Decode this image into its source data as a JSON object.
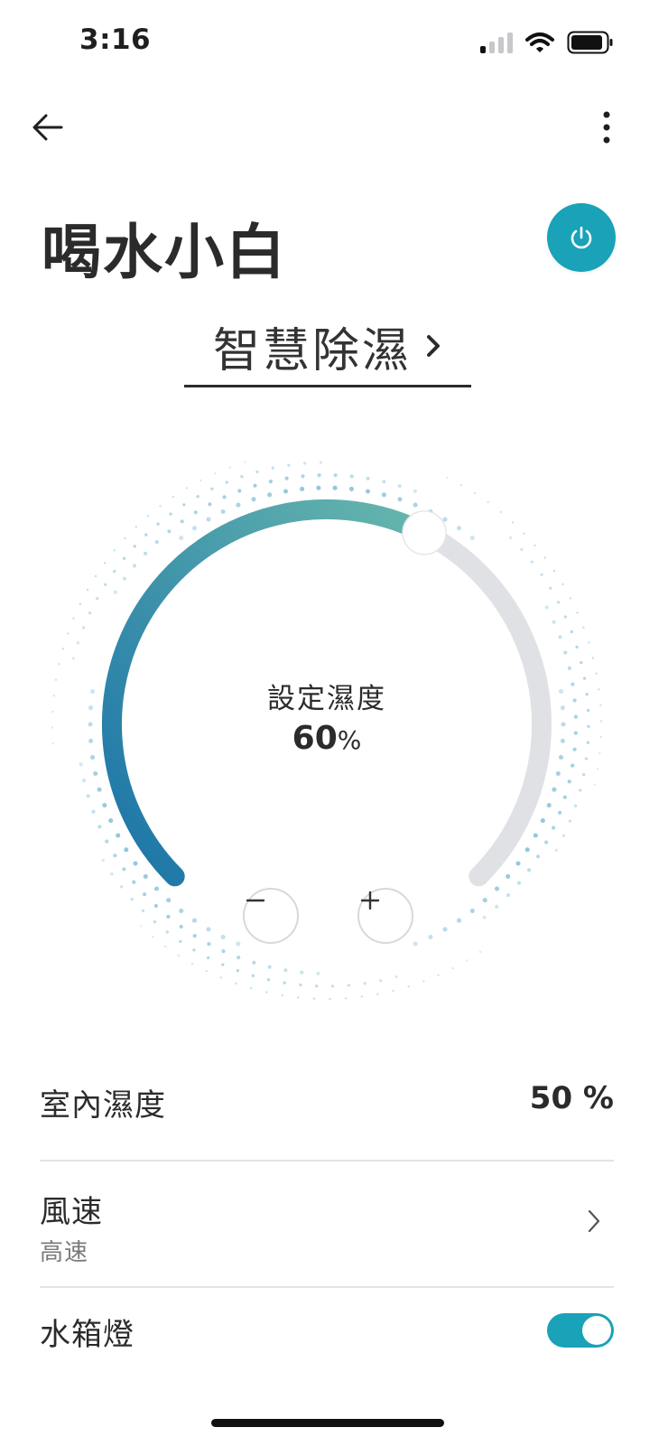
{
  "status_bar": {
    "time": "3:16",
    "signal_bars_active": 1,
    "signal_bars_total": 4,
    "icons": [
      "cellular-signal-icon",
      "wifi-icon",
      "battery-icon"
    ]
  },
  "nav": {
    "back_icon": "arrow-left-icon",
    "more_icon": "more-vertical-icon"
  },
  "device": {
    "name": "喝水小白",
    "power_icon": "power-icon",
    "power_color": "#19a2b8"
  },
  "mode": {
    "label": "智慧除濕",
    "chevron": "›"
  },
  "dial": {
    "label": "設定濕度",
    "value": "60",
    "unit": "%",
    "level_fraction": 0.6,
    "minus_icon": "minus-icon",
    "plus_icon": "plus-icon",
    "gradient_start": "#1a73a8",
    "gradient_end": "#67b7ad",
    "track_color": "#dfe1e5"
  },
  "settings": {
    "indoor_humidity": {
      "label": "室內濕度",
      "value": "50 %"
    },
    "fan_speed": {
      "label": "風速",
      "value": "高速"
    },
    "tank_light": {
      "label": "水箱燈",
      "on": true
    }
  }
}
